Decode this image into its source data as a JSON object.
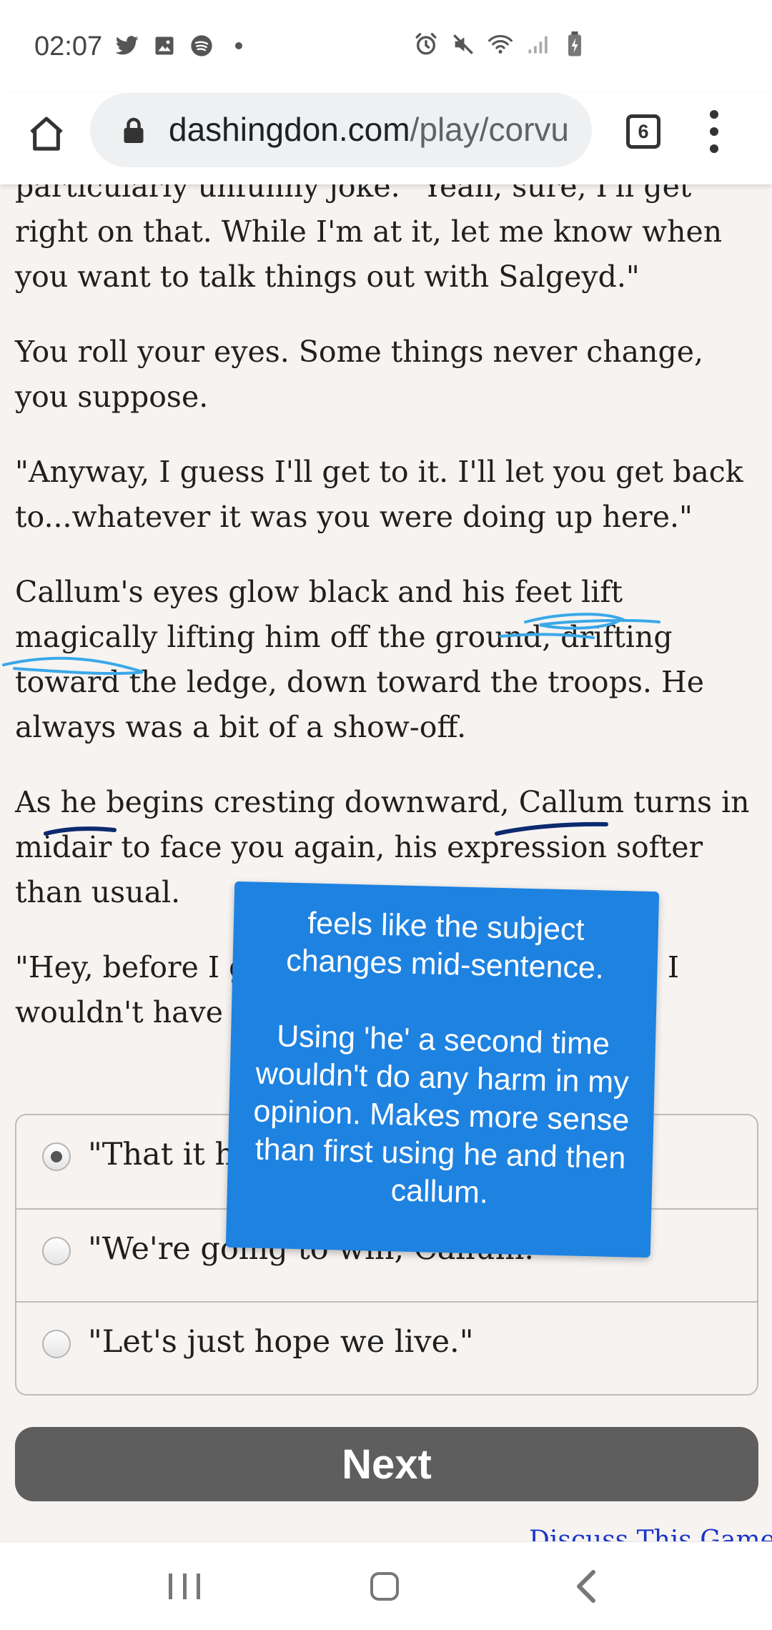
{
  "status_bar": {
    "time": "02:07",
    "left_icons": [
      "twitter-icon",
      "gallery-icon",
      "spotify-icon",
      "dot-icon"
    ],
    "right_icons": [
      "alarm-icon",
      "mute-icon",
      "wifi-icon",
      "signal-icon",
      "battery-icon"
    ]
  },
  "browser": {
    "url_host": "dashingdon.com",
    "url_path": "/play/corvu",
    "tab_count": "6"
  },
  "story": {
    "paragraphs": [
      "particularly unfunny joke. \"Yeah, sure, I'll get right on that. While I'm at it, let me know when you want to talk things out with Salgeyd.\"",
      "You roll your eyes. Some things never change, you suppose.",
      "\"Anyway, I guess I'll get to it. I'll let you get back to...whatever it was you were doing up here.\"",
      "Callum's eyes glow black and his feet lift magically lifting him off the ground, drifting toward the ledge, down toward the troops. He always was a bit of a show-off.",
      "As he begins cresting downward, Callum turns in midair to face you again, his expression softer than usual.",
      "\"Hey, before I go. Whatever happens today, I wouldn't have changed a thing.\""
    ]
  },
  "choices": [
    {
      "label": "\"That it has to be us.\"",
      "selected": true
    },
    {
      "label": "\"We're going to win, Callum.\"",
      "selected": false
    },
    {
      "label": "\"Let's just hope we live.\"",
      "selected": false
    }
  ],
  "next_button": "Next",
  "footer_link": "Discuss This Game",
  "annotation": {
    "note_line1": "feels like the subject changes mid-sentence.",
    "note_line2": "Using 'he' a second time wouldn't do any harm in my opinion. Makes more sense than first using he and then callum.",
    "color": "#1e82e1"
  },
  "colors": {
    "page_bg": "#f6f3f1",
    "button_bg": "#5e5e5e",
    "link": "#1a35c9"
  }
}
